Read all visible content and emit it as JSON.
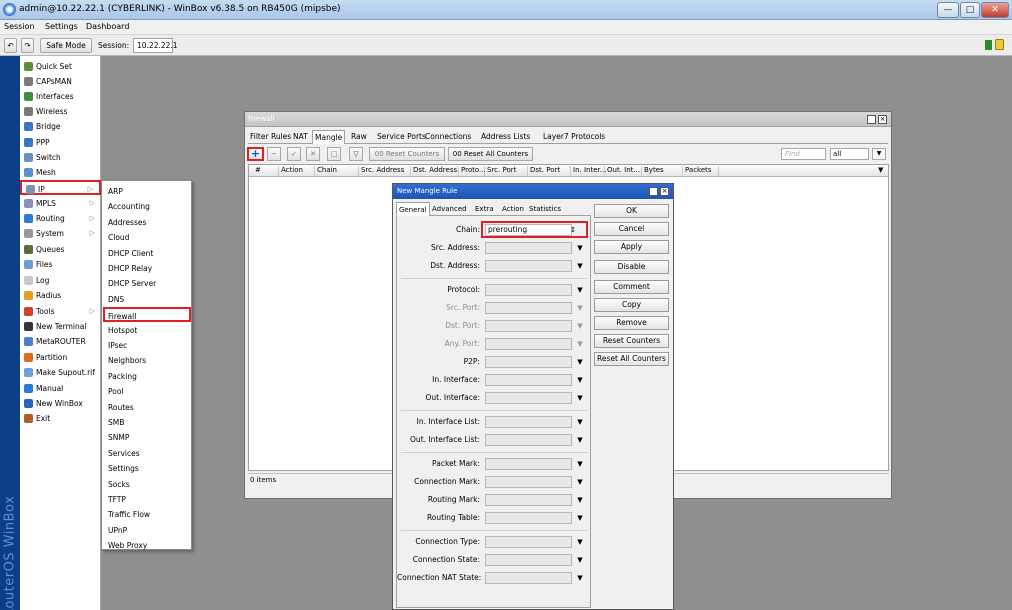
{
  "window": {
    "title": "admin@10.22.22.1 (CYBERLINK) - WinBox v6.38.5 on RB450G (mipsbe)",
    "min_label": "—",
    "max_label": "□",
    "close_label": "✕"
  },
  "menu": [
    "Session",
    "Settings",
    "Dashboard"
  ],
  "toolbar": {
    "undo_glyph": "↶",
    "redo_glyph": "↷",
    "safe_mode": "Safe Mode",
    "session_label": "Session:",
    "session_value": "10.22.22.1"
  },
  "brand": "RouterOS WinBox",
  "sidebar": {
    "items": [
      {
        "label": "Quick Set",
        "color": "#5a8f3a",
        "arrow": ""
      },
      {
        "label": "CAPsMAN",
        "color": "#7a7a7a",
        "arrow": ""
      },
      {
        "label": "Interfaces",
        "color": "#3c8f3c",
        "arrow": ""
      },
      {
        "label": "Wireless",
        "color": "#7a7a7a",
        "arrow": ""
      },
      {
        "label": "Bridge",
        "color": "#3a74c4",
        "arrow": ""
      },
      {
        "label": "PPP",
        "color": "#3a74c4",
        "arrow": ""
      },
      {
        "label": "Switch",
        "color": "#6b8fb8",
        "arrow": ""
      },
      {
        "label": "Mesh",
        "color": "#5a8fd0",
        "arrow": ""
      },
      {
        "label": "IP",
        "color": "#7b95b5",
        "arrow": "▷"
      },
      {
        "label": "MPLS",
        "color": "#8e8ebd",
        "arrow": "▷"
      },
      {
        "label": "Routing",
        "color": "#2e7bd1",
        "arrow": "▷"
      },
      {
        "label": "System",
        "color": "#999999",
        "arrow": "▷"
      },
      {
        "label": "Queues",
        "color": "#5a6e3c",
        "arrow": ""
      },
      {
        "label": "Files",
        "color": "#6a9fd4",
        "arrow": ""
      },
      {
        "label": "Log",
        "color": "#c9c9c9",
        "arrow": ""
      },
      {
        "label": "Radius",
        "color": "#e0a020",
        "arrow": ""
      },
      {
        "label": "Tools",
        "color": "#d23f2a",
        "arrow": "▷"
      },
      {
        "label": "New Terminal",
        "color": "#333333",
        "arrow": ""
      },
      {
        "label": "MetaROUTER",
        "color": "#4a7fc8",
        "arrow": ""
      },
      {
        "label": "Partition",
        "color": "#e06b1c",
        "arrow": ""
      },
      {
        "label": "Make Supout.rif",
        "color": "#6f9fd8",
        "arrow": ""
      },
      {
        "label": "Manual",
        "color": "#2c7ad6",
        "arrow": ""
      },
      {
        "label": "New WinBox",
        "color": "#2c63b8",
        "arrow": ""
      },
      {
        "label": "Exit",
        "color": "#b25b2b",
        "arrow": ""
      }
    ]
  },
  "ip_submenu": [
    "ARP",
    "Accounting",
    "Addresses",
    "Cloud",
    "DHCP Client",
    "DHCP Relay",
    "DHCP Server",
    "DNS",
    "Firewall",
    "Hotspot",
    "IPsec",
    "Neighbors",
    "Packing",
    "Pool",
    "Routes",
    "SMB",
    "SNMP",
    "Services",
    "Settings",
    "Socks",
    "TFTP",
    "Traffic Flow",
    "UPnP",
    "Web Proxy"
  ],
  "firewall": {
    "title": "Firewall",
    "tabs": [
      "Filter Rules",
      "NAT",
      "Mangle",
      "Raw",
      "Service Ports",
      "Connections",
      "Address Lists",
      "Layer7 Protocols"
    ],
    "active_tab": "Mangle",
    "toolbar": {
      "add": "+",
      "remove": "−",
      "enable": "✓",
      "disable": "✕",
      "comment": "□",
      "filter": "▽",
      "reset_counters": "00 Reset Counters",
      "reset_all_counters": "00 Reset All Counters",
      "find_placeholder": "Find",
      "find_scope": "all",
      "find_arrow": "▼"
    },
    "columns": [
      "#",
      "Action",
      "Chain",
      "Src. Address",
      "Dst. Address",
      "Proto...",
      "Src. Port",
      "Dst. Port",
      "In. Inter...",
      "Out. Int...",
      "Bytes",
      "Packets"
    ],
    "status": "0 items"
  },
  "dialog": {
    "title": "New Mangle Rule",
    "tabs": [
      "General",
      "Advanced",
      "Extra",
      "Action",
      "Statistics"
    ],
    "active_tab": "General",
    "fields": [
      {
        "label": "Chain:",
        "value": "prerouting",
        "dim": false,
        "white": true
      },
      {
        "label": "Src. Address:",
        "value": "",
        "dim": false,
        "white": false
      },
      {
        "label": "Dst. Address:",
        "value": "",
        "dim": false,
        "white": false
      },
      {
        "label": "Protocol:",
        "value": "",
        "dim": false,
        "white": false
      },
      {
        "label": "Src. Port:",
        "value": "",
        "dim": true,
        "white": false
      },
      {
        "label": "Dst. Port:",
        "value": "",
        "dim": true,
        "white": false
      },
      {
        "label": "Any. Port:",
        "value": "",
        "dim": true,
        "white": false
      },
      {
        "label": "P2P:",
        "value": "",
        "dim": false,
        "white": false
      },
      {
        "label": "In. Interface:",
        "value": "",
        "dim": false,
        "white": false
      },
      {
        "label": "Out. Interface:",
        "value": "",
        "dim": false,
        "white": false
      },
      {
        "label": "In. Interface List:",
        "value": "",
        "dim": false,
        "white": false
      },
      {
        "label": "Out. Interface List:",
        "value": "",
        "dim": false,
        "white": false
      },
      {
        "label": "Packet Mark:",
        "value": "",
        "dim": false,
        "white": false
      },
      {
        "label": "Connection Mark:",
        "value": "",
        "dim": false,
        "white": false
      },
      {
        "label": "Routing Mark:",
        "value": "",
        "dim": false,
        "white": false
      },
      {
        "label": "Routing Table:",
        "value": "",
        "dim": false,
        "white": false
      },
      {
        "label": "Connection Type:",
        "value": "",
        "dim": false,
        "white": false
      },
      {
        "label": "Connection State:",
        "value": "",
        "dim": false,
        "white": false
      },
      {
        "label": "Connection NAT State:",
        "value": "",
        "dim": false,
        "white": false
      }
    ],
    "buttons": [
      "OK",
      "Cancel",
      "Apply",
      "Disable",
      "Comment",
      "Copy",
      "Remove",
      "Reset Counters",
      "Reset All Counters"
    ],
    "dropdown_arrow": "▼",
    "chain_arrow": "↕"
  },
  "colors": {
    "highlight": "#e01f26",
    "desktop": "#0a4aa0",
    "workspace": "#8f8f8f",
    "dialog_title": "#1d55b4"
  }
}
